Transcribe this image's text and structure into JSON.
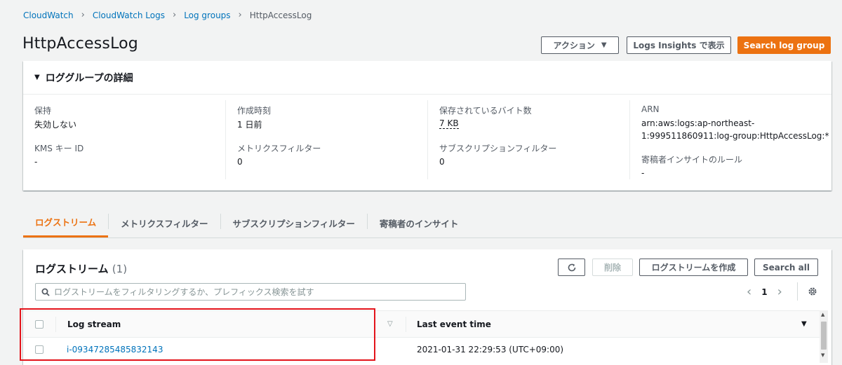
{
  "breadcrumb": {
    "items": [
      "CloudWatch",
      "CloudWatch Logs",
      "Log groups"
    ],
    "current": "HttpAccessLog"
  },
  "page_title": "HttpAccessLog",
  "header_actions": {
    "actions_label": "アクション",
    "insights_label": "Logs Insights で表示",
    "search_label": "Search log group"
  },
  "details": {
    "title": "ロググループの詳細",
    "retention_key": "保持",
    "retention_val": "失効しない",
    "kms_key": "KMS キー ID",
    "kms_val": "-",
    "created_key": "作成時刻",
    "created_val": "1 日前",
    "metric_filter_key": "メトリクスフィルター",
    "metric_filter_val": "0",
    "stored_bytes_key": "保存されているバイト数",
    "stored_bytes_val": "7 KB",
    "subscription_key": "サブスクリプションフィルター",
    "subscription_val": "0",
    "arn_key": "ARN",
    "arn_line1": "arn:aws:logs:ap-northeast-",
    "arn_line2": "1:999511860911:log-group:HttpAccessLog:*",
    "contributor_key": "寄稿者インサイトのルール",
    "contributor_val": "-"
  },
  "tabs": [
    "ログストリーム",
    "メトリクスフィルター",
    "サブスクリプションフィルター",
    "寄稿者のインサイト"
  ],
  "streams": {
    "title": "ログストリーム",
    "count": "(1)",
    "delete_label": "削除",
    "create_label": "ログストリームを作成",
    "search_all_label": "Search all",
    "search_placeholder": "ログストリームをフィルタリングするか、プレフィックス検索を試す",
    "page": "1",
    "columns": [
      "Log stream",
      "Last event time"
    ],
    "rows": [
      {
        "name": "i-09347285485832143",
        "last_event": "2021-01-31 22:29:53 (UTC+09:00)"
      }
    ]
  },
  "colors": {
    "accent": "#ec7211",
    "link": "#0073bb",
    "highlight": "#e3141b"
  }
}
